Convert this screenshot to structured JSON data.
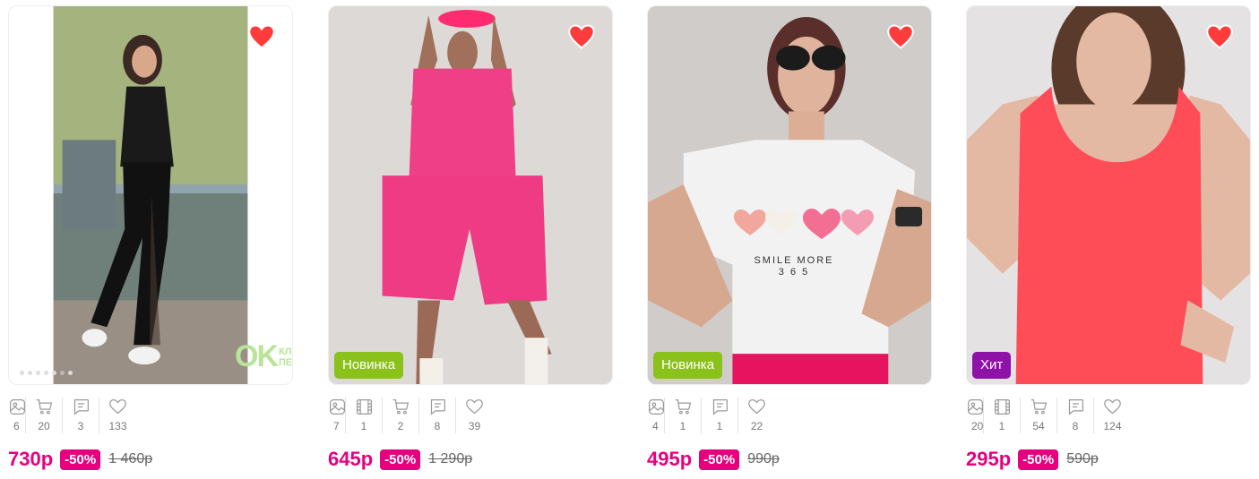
{
  "products": [
    {
      "badge": "",
      "stats": {
        "photos": "6",
        "videos": "",
        "bought": "20",
        "reviews": "3",
        "likes": "133"
      },
      "price": "730р",
      "discount": "-50%",
      "old_price": "1 460р",
      "watermark_lines": [
        "КЛ",
        "ПЕ"
      ]
    },
    {
      "badge": "Новинка",
      "stats": {
        "photos": "7",
        "videos": "1",
        "bought": "2",
        "reviews": "8",
        "likes": "39"
      },
      "price": "645р",
      "discount": "-50%",
      "old_price": "1 290р"
    },
    {
      "badge": "Новинка",
      "stats": {
        "photos": "4",
        "videos": "",
        "bought": "1",
        "reviews": "1",
        "likes": "22"
      },
      "price": "495р",
      "discount": "-50%",
      "old_price": "990р",
      "shirt_print": [
        "SMILE MORE",
        "3 6 5"
      ]
    },
    {
      "badge": "Хит",
      "stats": {
        "photos": "20",
        "videos": "1",
        "bought": "54",
        "reviews": "8",
        "likes": "124"
      },
      "price": "295р",
      "discount": "-50%",
      "old_price": "590р"
    }
  ],
  "colors": {
    "accent": "#e6007e",
    "new_badge": "#8ac11b",
    "hit_badge": "#8e11a8",
    "heart": "#ff3b3b"
  },
  "icons": [
    "image-icon",
    "video-icon",
    "cart-icon",
    "review-icon",
    "heart-outline-icon",
    "heart-filled-icon"
  ]
}
